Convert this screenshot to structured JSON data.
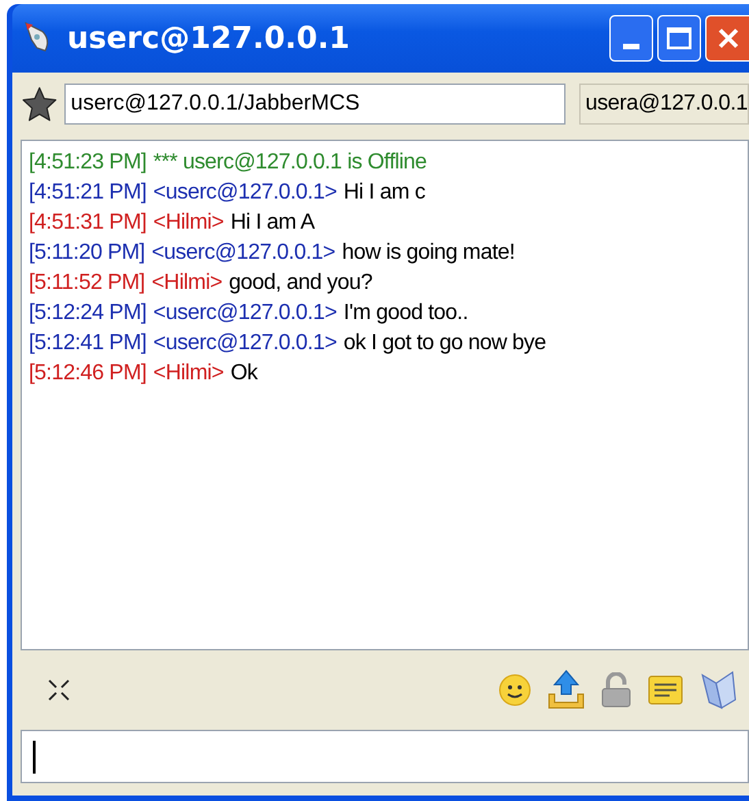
{
  "window": {
    "title": "userc@127.0.0.1"
  },
  "toolbar": {
    "resource": "userc@127.0.0.1/JabberMCS",
    "contact": "usera@127.0.0.1"
  },
  "messages": [
    {
      "kind": "status",
      "color": "#2e8b2e",
      "time": "[4:51:23 PM]",
      "text": "*** userc@127.0.0.1 is Offline"
    },
    {
      "kind": "message",
      "color": "#1c2fb0",
      "time": "[4:51:21 PM]",
      "sender": "<userc@127.0.0.1>",
      "text": "Hi I am c"
    },
    {
      "kind": "message",
      "color": "#d02020",
      "time": "[4:51:31 PM]",
      "sender": "<Hilmi>",
      "text": "Hi I am A"
    },
    {
      "kind": "message",
      "color": "#1c2fb0",
      "time": "[5:11:20 PM]",
      "sender": "<userc@127.0.0.1>",
      "text": "how is going mate!"
    },
    {
      "kind": "message",
      "color": "#d02020",
      "time": "[5:11:52 PM]",
      "sender": "<Hilmi>",
      "text": "good, and you?"
    },
    {
      "kind": "message",
      "color": "#1c2fb0",
      "time": "[5:12:24 PM]",
      "sender": "<userc@127.0.0.1>",
      "text": "I'm good too.."
    },
    {
      "kind": "message",
      "color": "#1c2fb0",
      "time": "[5:12:41 PM]",
      "sender": "<userc@127.0.0.1>",
      "text": "ok I got to go now bye"
    },
    {
      "kind": "message",
      "color": "#d02020",
      "time": "[5:12:46 PM]",
      "sender": "<Hilmi>",
      "text": "Ok"
    }
  ]
}
